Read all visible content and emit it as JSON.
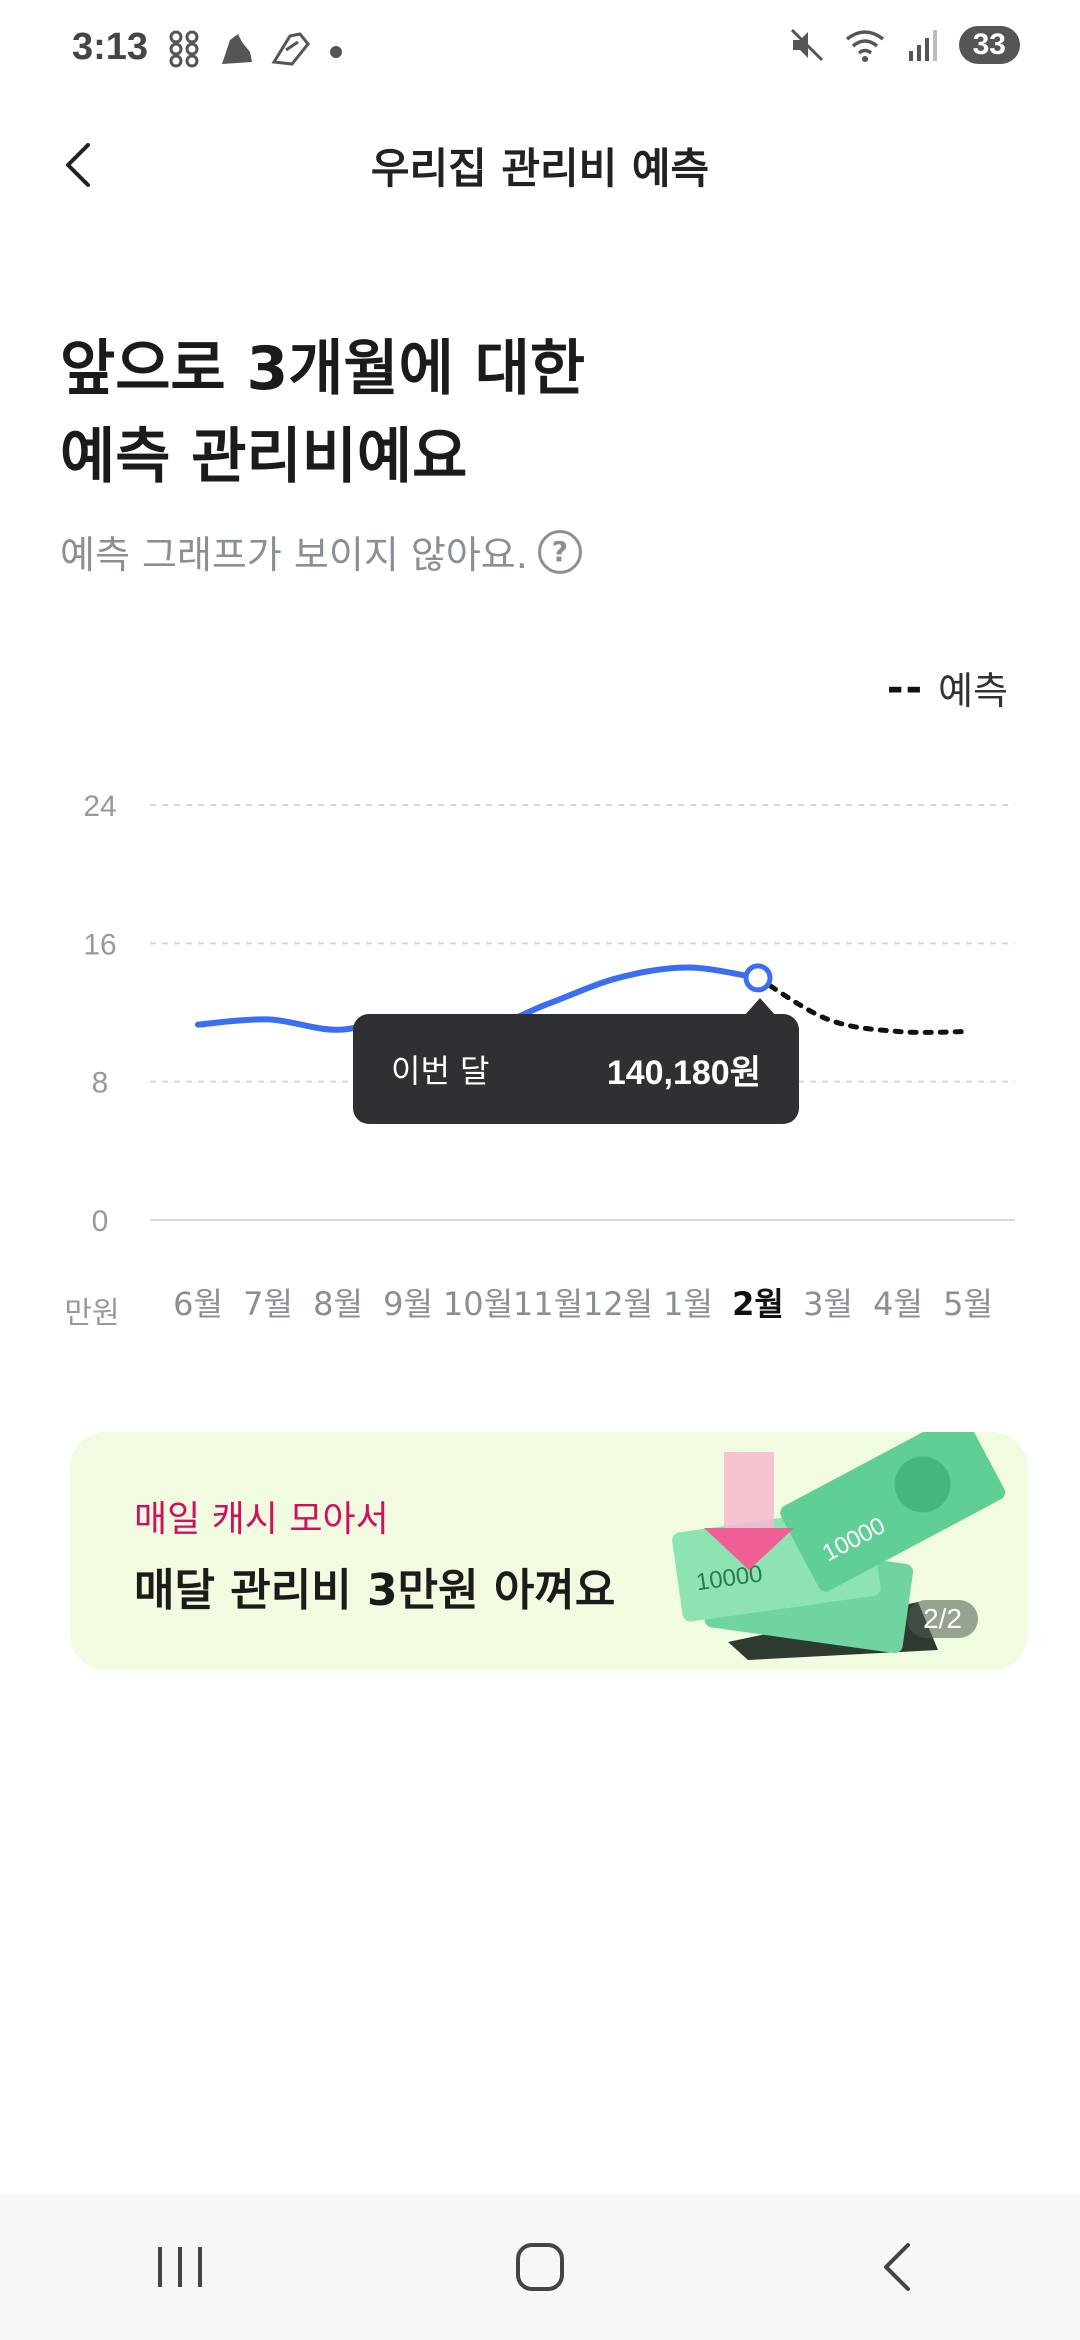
{
  "status_bar": {
    "time": "3:13",
    "battery": "33",
    "left_icons": [
      "grid-app-icon",
      "shoe-icon",
      "shoe-outline-icon",
      "dot-icon"
    ],
    "right_icons": [
      "mute-icon",
      "wifi-icon",
      "signal-icon"
    ]
  },
  "header": {
    "title": "우리집 관리비 예측"
  },
  "headline": {
    "line1": "앞으로 3개월에 대한",
    "line2": "예측 관리비예요",
    "sub": "예측 그래프가 보이지 않아요.",
    "help_glyph": "?"
  },
  "legend": {
    "dash": "--",
    "label": "예측"
  },
  "chart_data": {
    "type": "line",
    "unit_label": "만원",
    "categories": [
      "6월",
      "7월",
      "8월",
      "9월",
      "10월",
      "11월",
      "12월",
      "1월",
      "2월",
      "3월",
      "4월",
      "5월"
    ],
    "active_category": "2월",
    "series": [
      {
        "values": [
          11.3,
          11.6,
          11.0,
          11.7,
          11.0,
          12.5,
          14.0,
          14.6,
          14.0,
          null,
          null,
          null
        ],
        "color": "#3b6ef0"
      },
      {
        "name": "예측",
        "values": [
          null,
          null,
          null,
          null,
          null,
          null,
          null,
          null,
          14.0,
          11.6,
          10.9,
          10.9
        ],
        "color": "#111111",
        "dashed": true
      }
    ],
    "yticks": [
      0,
      8,
      16,
      24
    ],
    "ylim": [
      0,
      24
    ],
    "grid": true
  },
  "tooltip": {
    "label": "이번 달",
    "value": "140,180원"
  },
  "banner": {
    "sub": "매일 캐시 모아서",
    "main": "매달 관리비 3만원 아껴요",
    "pager_current": "2",
    "pager_sep": "/",
    "pager_total": "2",
    "bill_text": "10000",
    "accent": "#d0105e",
    "bg": "#f0fbdf"
  }
}
